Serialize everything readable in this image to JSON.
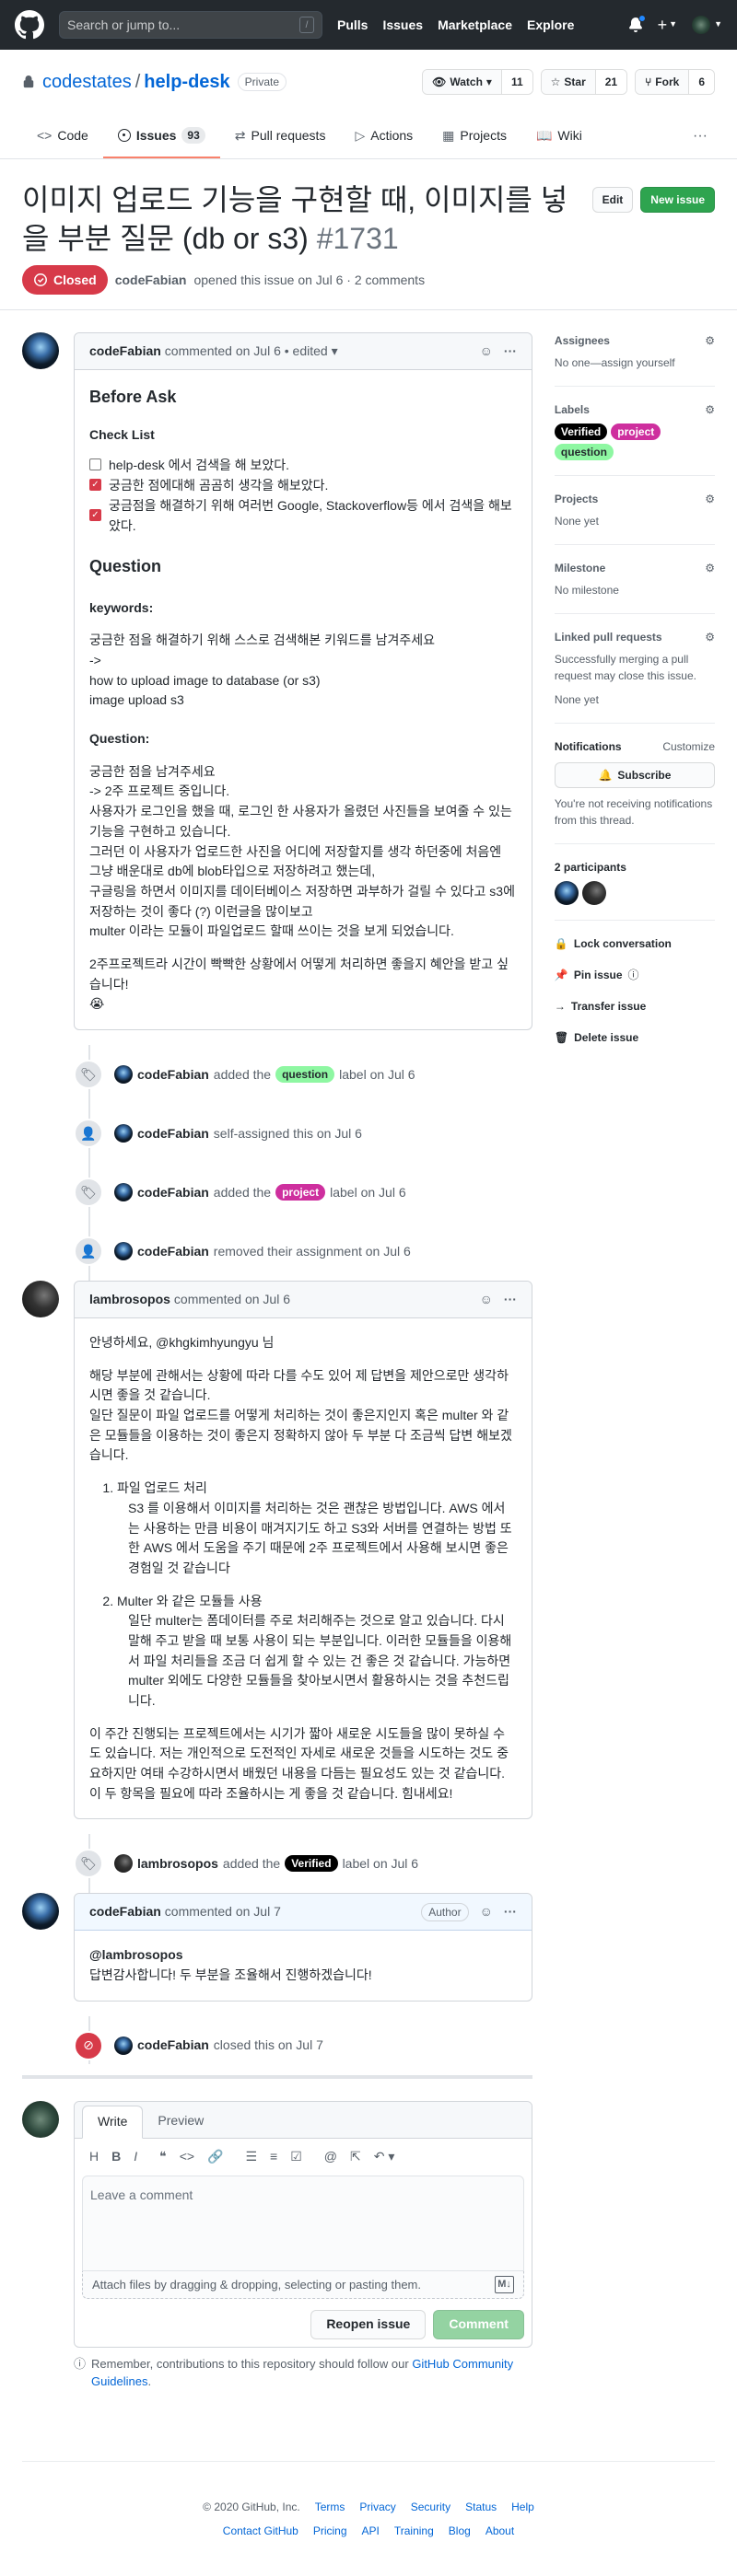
{
  "header": {
    "search_placeholder": "Search or jump to...",
    "search_key": "/",
    "nav": [
      "Pulls",
      "Issues",
      "Marketplace",
      "Explore"
    ]
  },
  "repo": {
    "owner": "codestates",
    "name": "help-desk",
    "visibility": "Private",
    "watch_label": "Watch",
    "watch_count": "11",
    "star_label": "Star",
    "star_count": "21",
    "fork_label": "Fork",
    "fork_count": "6"
  },
  "tabs": [
    {
      "label": "Code"
    },
    {
      "label": "Issues",
      "count": "93"
    },
    {
      "label": "Pull requests"
    },
    {
      "label": "Actions"
    },
    {
      "label": "Projects"
    },
    {
      "label": "Wiki"
    }
  ],
  "issue": {
    "title": "이미지 업로드 기능을 구현할 때, 이미지를 넣을 부분 질문 (db or s3)",
    "number": "#1731",
    "edit_label": "Edit",
    "new_issue_label": "New issue",
    "state": "Closed",
    "author": "codeFabian",
    "meta": "opened this issue on Jul 6 · 2 comments"
  },
  "comments": {
    "first": {
      "author": "codeFabian",
      "meta": "commented on Jul 6 • edited ▾",
      "h_before": "Before Ask",
      "h_check": "Check List",
      "checks": [
        {
          "text": "help-desk 에서 검색을 해 보았다.",
          "checked": false
        },
        {
          "text": "궁금한 점에대해 곰곰히 생각을 해보았다.",
          "checked": true
        },
        {
          "text": "궁금점을 해결하기 위해 여러번 Google, Stackoverflow등 에서 검색을 해보았다.",
          "checked": true
        }
      ],
      "h_question": "Question",
      "h_keywords": "keywords:",
      "kw_lines": [
        "궁금한 점을 해결하기 위해 스스로 검색해본 키워드를 남겨주세요",
        "->",
        "how to upload image to database (or s3)",
        "image upload s3"
      ],
      "h_q2": "Question:",
      "q_lines": [
        "궁금한 점을 남겨주세요",
        "-> 2주 프로젝트 중입니다.",
        "사용자가 로그인을 했을 때, 로그인 한 사용자가 올렸던 사진들을 보여줄 수 있는 기능을 구현하고 있습니다.",
        "그러던 이 사용자가 업로드한 사진을 어디에 저장할지를 생각 하던중에 처음엔 그냥 배운대로 db에 blob타입으로 저장하려고 했는데,",
        "구글링을 하면서 이미지를 데이터베이스 저장하면 과부하가 걸릴 수 있다고 s3에 저장하는 것이 좋다 (?) 이런글을 많이보고",
        "multer 이라는 모듈이 파일업로드 할때 쓰이는 것을 보게 되었습니다."
      ],
      "last": "2주프로젝트라 시간이 빡빡한 상황에서 어떻게 처리하면 좋을지 혜안을 받고 싶습니다!",
      "emoji": "😭"
    },
    "second": {
      "author": "lambrosopos",
      "meta": "commented on Jul 6",
      "greet": "안녕하세요, @khgkimhyungyu 님",
      "p1": "해당 부분에 관해서는 상황에 따라 다를 수도 있어 제 답변을 제안으로만 생각하시면 좋을 것 같습니다.",
      "p2": "일단 질문이 파일 업로드를 어떻게 처리하는 것이 좋은지인지 혹은 multer 와 같은 모듈들을 이용하는 것이 좋은지 정확하지 않아 두 부분 다 조금씩 답변 해보겠습니다.",
      "items": [
        {
          "title": "파일 업로드 처리",
          "text": "S3 를 이용해서 이미지를 처리하는 것은 괜찮은 방법입니다. AWS 에서는 사용하는 만큼 비용이 매겨지기도 하고 S3와 서버를 연결하는 방법 또한 AWS 에서 도움을 주기 때문에 2주 프로젝트에서 사용해 보시면 좋은 경험일 것 같습니다"
        },
        {
          "title": "Multer 와 같은 모듈들 사용",
          "text": "일단 multer는 폼데이터를 주로 처리해주는 것으로 알고 있습니다. 다시 말해 주고 받을 때 보통 사용이 되는 부분입니다. 이러한 모듈들을 이용해서 파일 처리들을 조금 더 쉽게 할 수 있는 건 좋은 것 같습니다. 가능하면 multer 외에도 다양한 모듈들을 찾아보시면서 활용하시는 것을 추천드립니다."
        }
      ],
      "p3": "이 주간 진행되는 프로젝트에서는 시기가 짧아 새로운 시도들을 많이 못하실 수도 있습니다. 저는 개인적으로 도전적인 자세로 새로운 것들을 시도하는 것도 중요하지만 여태 수강하시면서 배웠던 내용을 다듬는 필요성도 있는 것 같습니다. 이 두 항목을 필요에 따라 조율하시는 게 좋을 것 같습니다. 힘내세요!"
    },
    "third": {
      "author": "codeFabian",
      "meta": "commented on Jul 7",
      "badge": "Author",
      "mention": "@lambrosopos",
      "text": "답변감사합니다! 두 부분을 조율해서 진행하겠습니다!"
    }
  },
  "events": {
    "e1": {
      "actor": "codeFabian",
      "pre": "added the",
      "label": "question",
      "post": "label on Jul 6"
    },
    "e2": {
      "actor": "codeFabian",
      "text": "self-assigned this on Jul 6"
    },
    "e3": {
      "actor": "codeFabian",
      "pre": "added the",
      "label": "project",
      "post": "label on Jul 6"
    },
    "e4": {
      "actor": "codeFabian",
      "text": "removed their assignment on Jul 6"
    },
    "e5": {
      "actor": "lambrosopos",
      "pre": "added the",
      "label": "Verified",
      "post": "label on Jul 6"
    },
    "e6": {
      "actor": "codeFabian",
      "text": "closed this on Jul 7"
    }
  },
  "editor": {
    "tab_write": "Write",
    "tab_preview": "Preview",
    "placeholder": "Leave a comment",
    "attach": "Attach files by dragging & dropping, selecting or pasting them.",
    "reopen": "Reopen issue",
    "comment": "Comment",
    "guide_pre": "Remember, contributions to this repository should follow our",
    "guide_link": "GitHub Community Guidelines",
    "guide_post": "."
  },
  "sidebar": {
    "assignees_h": "Assignees",
    "assignees_v": "No one—assign yourself",
    "labels_h": "Labels",
    "labels": [
      "Verified",
      "project",
      "question"
    ],
    "projects_h": "Projects",
    "projects_v": "None yet",
    "milestone_h": "Milestone",
    "milestone_v": "No milestone",
    "linked_h": "Linked pull requests",
    "linked_desc": "Successfully merging a pull request may close this issue.",
    "linked_v": "None yet",
    "notif_h": "Notifications",
    "notif_custom": "Customize",
    "subscribe": "Subscribe",
    "notif_desc": "You're not receiving notifications from this thread.",
    "participants_h": "2 participants",
    "lock": "Lock conversation",
    "pin": "Pin issue",
    "transfer": "Transfer issue",
    "delete": "Delete issue"
  },
  "footer": {
    "copyright": "© 2020 GitHub, Inc.",
    "row1": [
      "Terms",
      "Privacy",
      "Security",
      "Status",
      "Help"
    ],
    "row2": [
      "Contact GitHub",
      "Pricing",
      "API",
      "Training",
      "Blog",
      "About"
    ]
  },
  "colors": {
    "accent": "#0366d6",
    "closed": "#d73a49",
    "green": "#2ea44f",
    "label_question": "#8ef7a2",
    "label_project": "#ce2f9e",
    "label_verified": "#000000"
  }
}
